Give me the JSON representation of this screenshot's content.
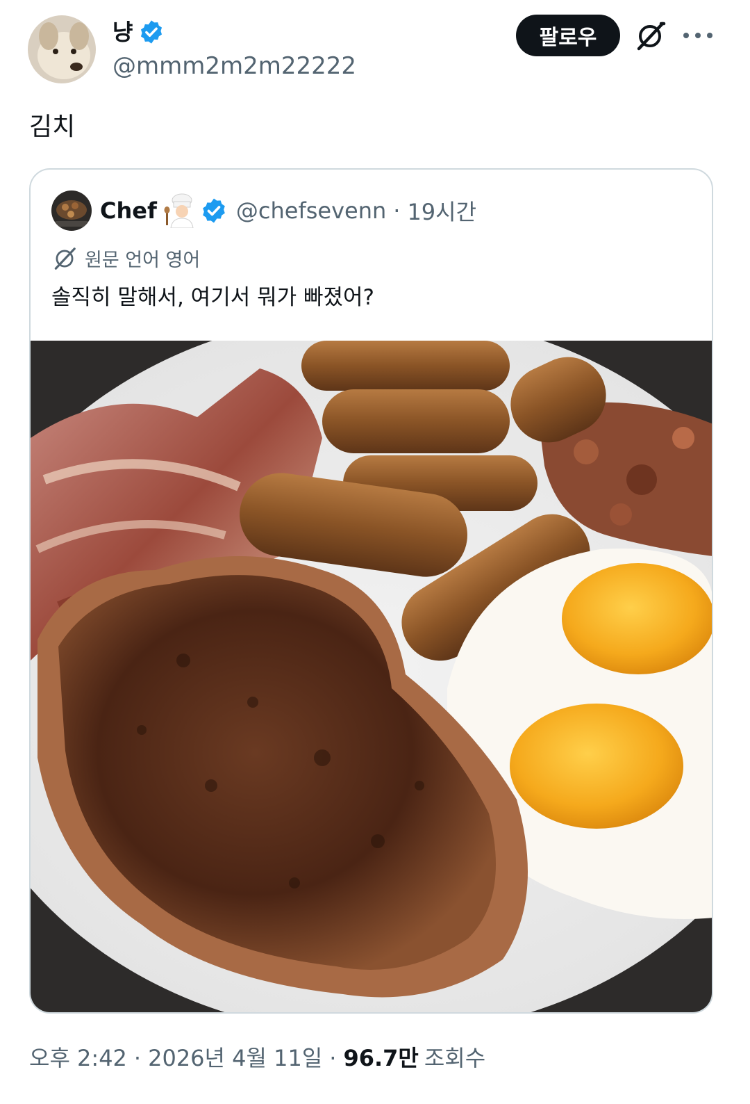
{
  "author": {
    "display_name": "냥",
    "handle": "@mmm2m2m22222",
    "avatar_icon": "dog-avatar",
    "verified_icon": "verified-badge-icon",
    "verified_color": "#1d9bf0"
  },
  "actions": {
    "follow_label": "팔로우",
    "grok_icon": "grok-icon",
    "more_icon": "more-icon"
  },
  "tweet": {
    "text": "김치"
  },
  "quote": {
    "display_name": "Chef",
    "emoji_icon": "chef-emoji-icon",
    "handle": "@chefsevenn",
    "separator": "·",
    "time": "19시간",
    "translate_label": "원문 언어 영어",
    "text": "솔직히 말해서, 여기서 뭐가 빠졌어?",
    "image_icon": "breakfast-plate-photo"
  },
  "meta": {
    "time": "오후 2:42",
    "separator": "·",
    "date": "2026년 4월 11일",
    "views_count": "96.7만",
    "views_label": "조회수"
  }
}
